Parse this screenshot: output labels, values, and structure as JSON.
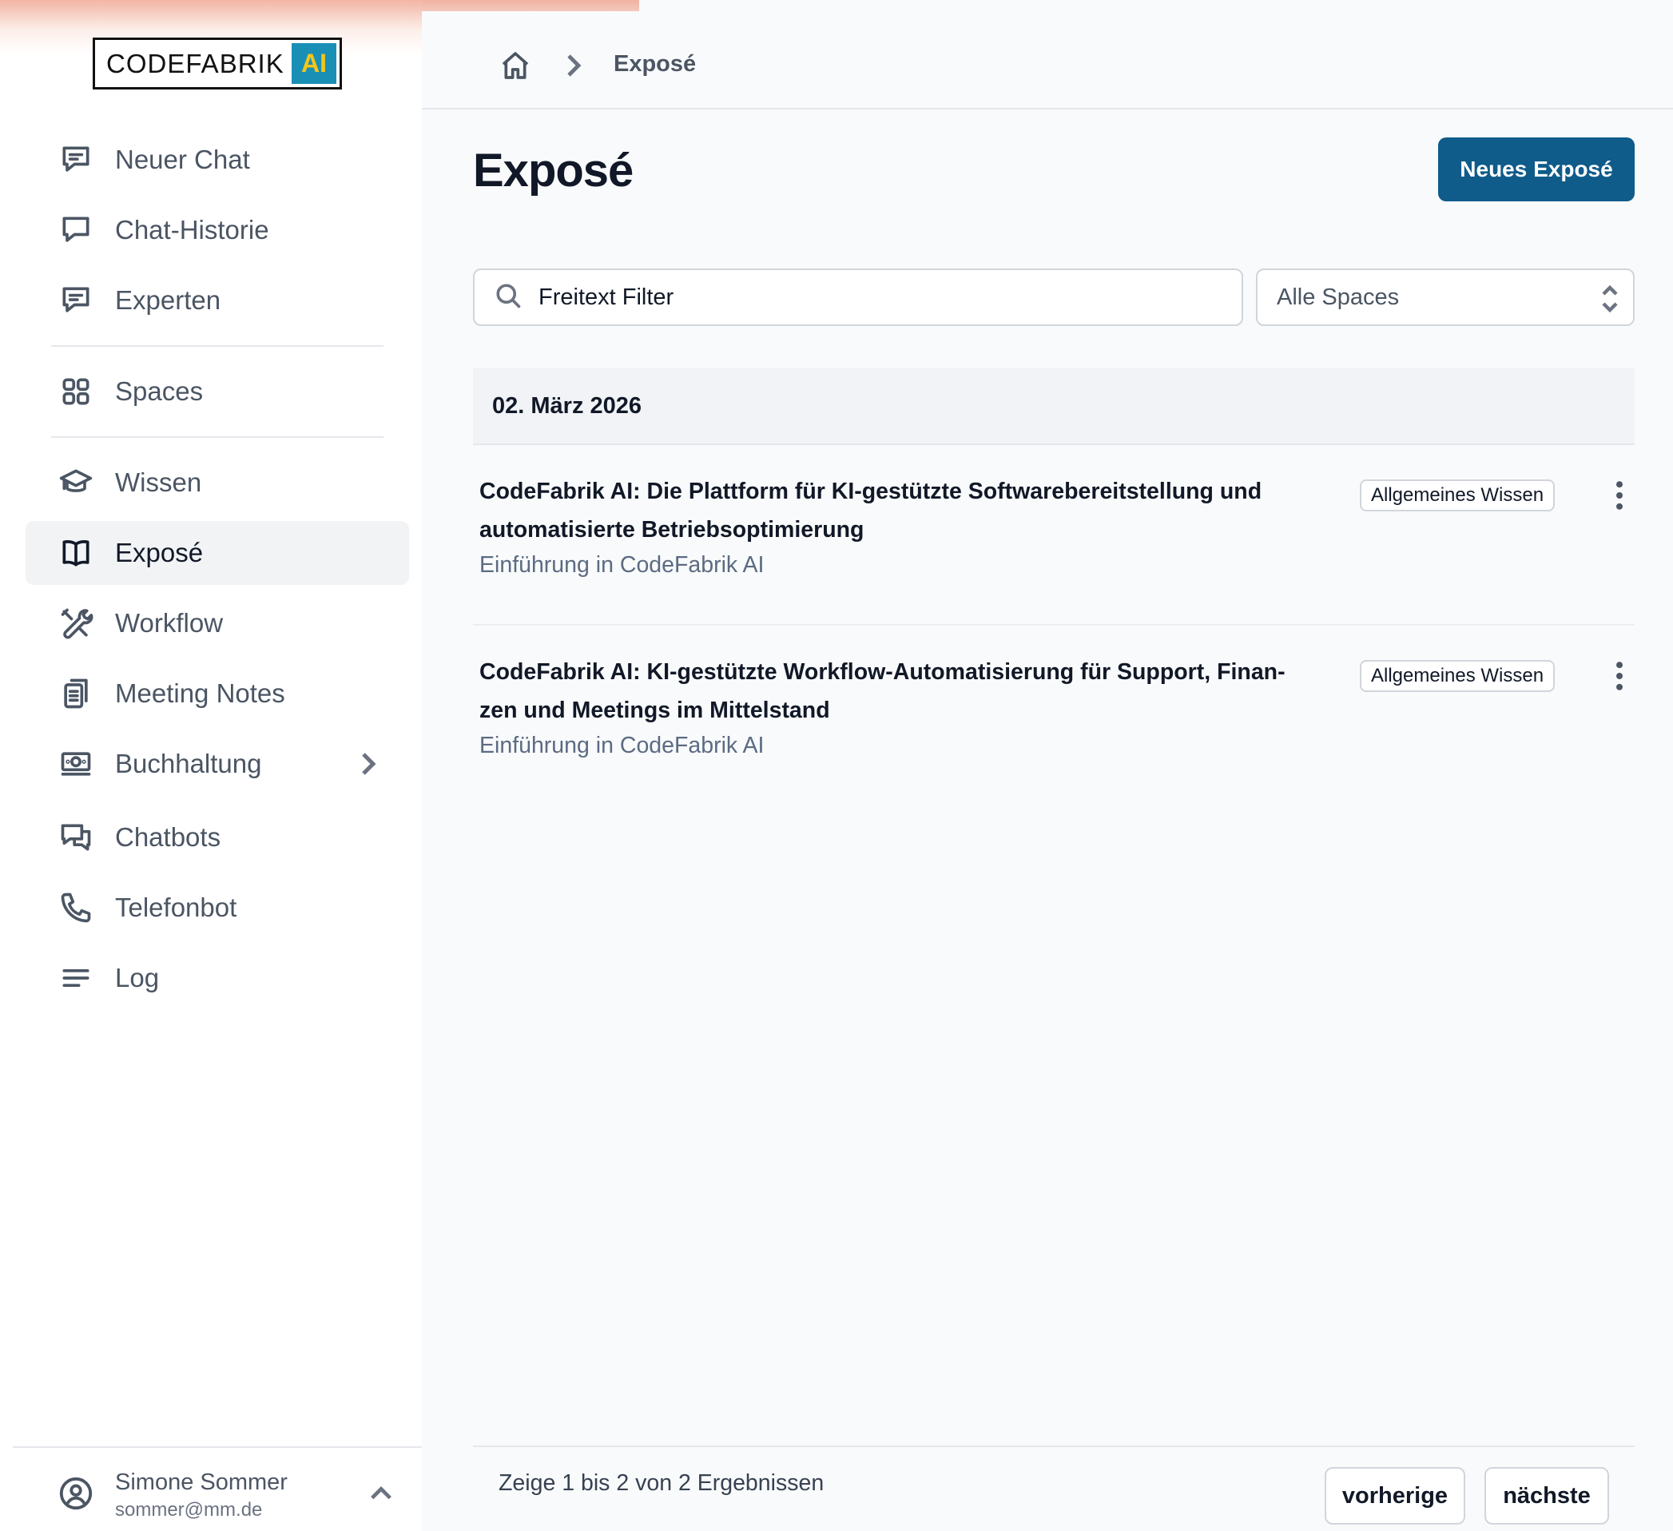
{
  "app": {
    "logo_text": "CODEFABRIK",
    "logo_badge": "AI",
    "brand_color": "#0f5b8a",
    "logo_badge_color": "#1a8fb5"
  },
  "sidebar": {
    "items": [
      {
        "label": "Neuer Chat",
        "icon": "chat-bubble-lines-icon",
        "active": false
      },
      {
        "label": "Chat-Historie",
        "icon": "chat-bubble-icon",
        "active": false
      },
      {
        "label": "Experten",
        "icon": "chat-bubble-lines-icon",
        "active": false
      },
      {
        "label": "Spaces",
        "icon": "grid-squares-icon",
        "active": false
      },
      {
        "label": "Wissen",
        "icon": "graduation-cap-icon",
        "active": false
      },
      {
        "label": "Exposé",
        "icon": "open-book-icon",
        "active": true
      },
      {
        "label": "Workflow",
        "icon": "wrench-screwdriver-icon",
        "active": false
      },
      {
        "label": "Meeting Notes",
        "icon": "clipboard-icon",
        "active": false
      },
      {
        "label": "Buchhaltung",
        "icon": "banknotes-icon",
        "active": false,
        "has_submenu": true
      },
      {
        "label": "Chatbots",
        "icon": "chat-bubbles-icon",
        "active": false
      },
      {
        "label": "Telefonbot",
        "icon": "phone-icon",
        "active": false
      },
      {
        "label": "Log",
        "icon": "menu-lines-icon",
        "active": false
      }
    ],
    "user": {
      "name": "Simone Sommer",
      "email": "sommer@mm.de"
    }
  },
  "breadcrumb": {
    "current": "Exposé"
  },
  "main": {
    "title": "Exposé",
    "new_button": "Neues Exposé",
    "search_placeholder": "Freitext Filter",
    "space_select": "Alle Spaces",
    "date_group": "02. März 2026",
    "entries": [
      {
        "title": "CodeFabrik AI: Die Plattform für KI-gestützte Softwarebereitstellung und automatisierte Betriebsoptimierung",
        "subtitle": "Einführung in CodeFabrik AI",
        "tag": "Allgemeines Wissen"
      },
      {
        "title": "CodeFabrik AI: KI-gestützte Workflow-Automatisierung für Support, Finan-zen und Meetings im Mittelstand",
        "subtitle": "Einführung in CodeFabrik AI",
        "tag": "Allgemeines Wissen"
      }
    ],
    "pagination": {
      "info": "Zeige 1 bis 2 von 2 Ergebnissen",
      "prev": "vorherige",
      "next": "nächste"
    }
  }
}
